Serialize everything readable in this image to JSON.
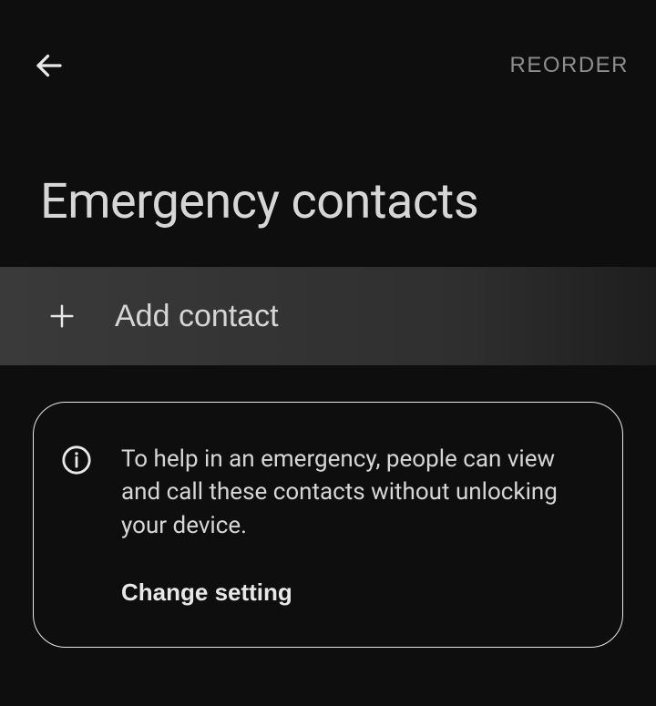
{
  "header": {
    "reorder_label": "REORDER"
  },
  "page": {
    "title": "Emergency contacts"
  },
  "add_contact": {
    "label": "Add contact"
  },
  "info_card": {
    "message": "To help in an emergency, people can view and call these contacts without unlocking your device.",
    "action_label": "Change setting"
  }
}
